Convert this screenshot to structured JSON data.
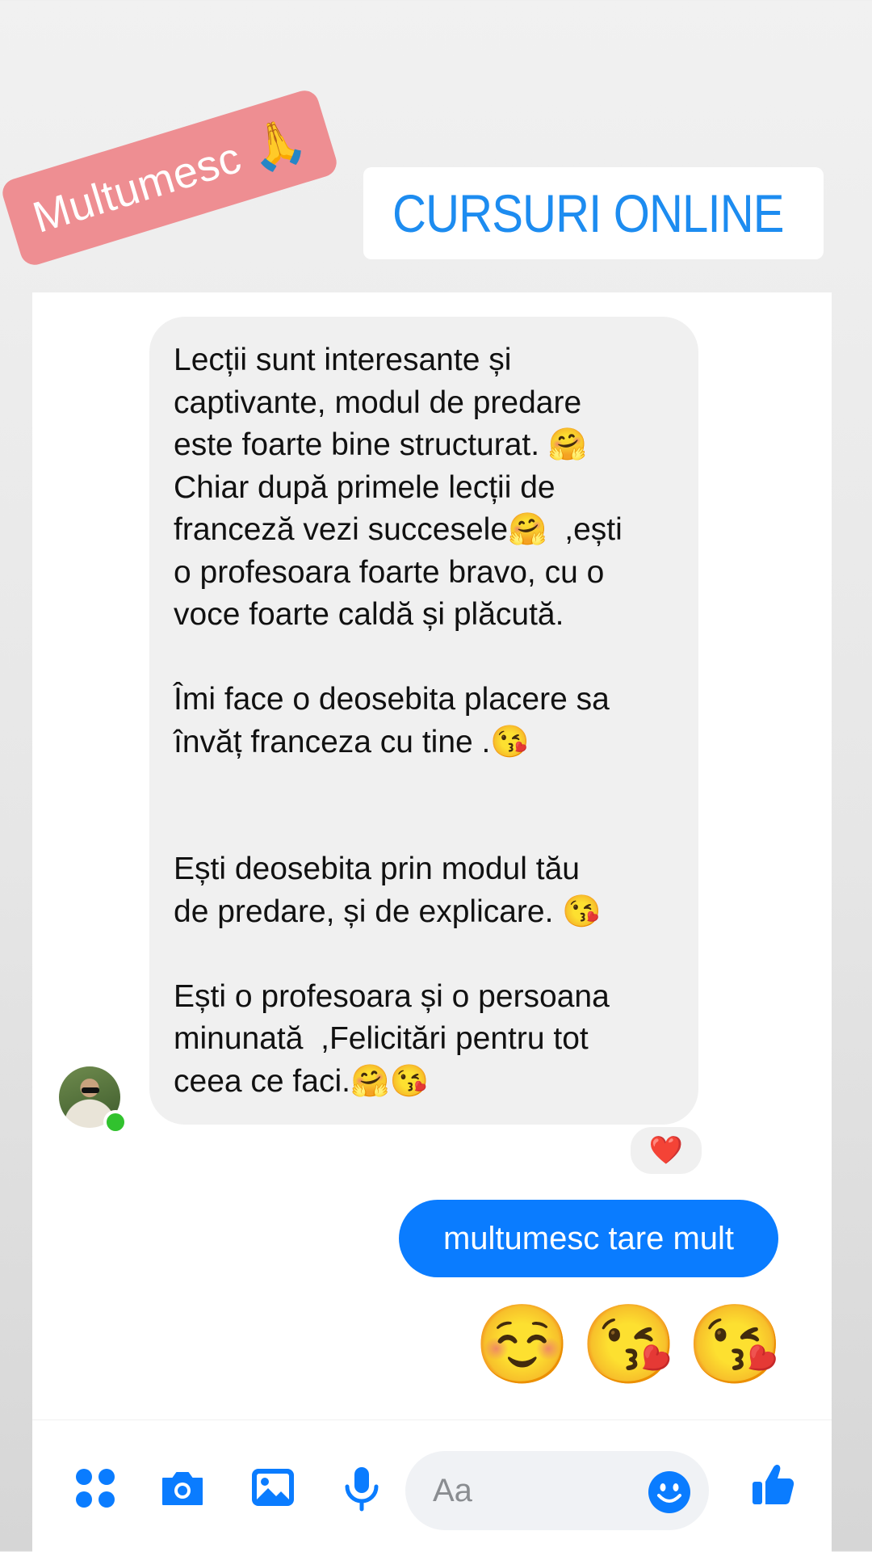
{
  "stickers": {
    "thanks_text": "Multumesc",
    "thanks_emoji": "🙏",
    "link_text": "CURSURI ONLINE"
  },
  "chat": {
    "incoming_message": "Lecții sunt interesante și\ncaptivante, modul de predare\neste foarte bine structurat. 🤗\nChiar după primele lecții de\nfranceză vezi succesele🤗  ,ești\no profesoara foarte bravo, cu o\nvoce foarte caldă și plăcută.\n\nÎmi face o deosebita placere sa\nînvăț franceza cu tine .😘\n\n\nEști deosebita prin modul tău\nde predare, și de explicare. 😘\n\nEști o profesoara și o persoana\nminunată  ,Felicitări pentru tot\nceea ce faci.🤗😘",
    "reaction": "❤️",
    "outgoing_message": "multumesc tare mult",
    "outgoing_emojis": [
      "☺️",
      "😘",
      "😘"
    ]
  },
  "composer": {
    "placeholder": "Aa",
    "icons": [
      "apps-icon",
      "camera-icon",
      "image-icon",
      "microphone-icon",
      "emoji-icon",
      "like-icon"
    ]
  },
  "colors": {
    "accent": "#0a7cff",
    "link": "#1d8cf0",
    "sticker_bg": "#ee8e92",
    "online": "#31c22e"
  }
}
